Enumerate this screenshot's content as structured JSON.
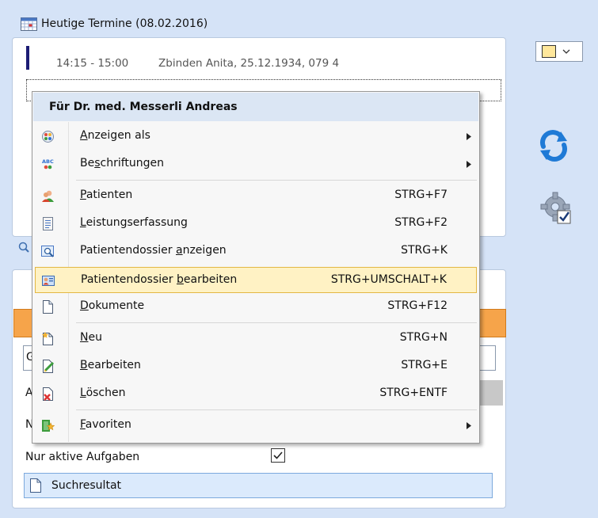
{
  "header": {
    "title": "Heutige Termine (08.02.2016)"
  },
  "appointments": [
    {
      "time": "14:15 - 15:00",
      "patient": "Zbinden Anita, 25.12.1934, 079 4"
    }
  ],
  "context_menu": {
    "title": "Für Dr. med. Messerli Andreas",
    "items": [
      {
        "pre": "",
        "acc": "A",
        "post": "nzeigen als",
        "shortcut": "",
        "icon": "display-as-icon"
      },
      {
        "pre": "Be",
        "acc": "s",
        "post": "chriftungen",
        "shortcut": "",
        "icon": "abc-labels-icon"
      },
      {
        "pre": "",
        "acc": "P",
        "post": "atienten",
        "shortcut": "STRG+F7",
        "icon": "patients-icon"
      },
      {
        "pre": "",
        "acc": "L",
        "post": "eistungserfassung",
        "shortcut": "STRG+F2",
        "icon": "service-recording-icon"
      },
      {
        "pre": "Patientendossier ",
        "acc": "a",
        "post": "nzeigen",
        "shortcut": "STRG+K",
        "icon": "view-dossier-icon"
      },
      {
        "pre": "Patientendossier ",
        "acc": "b",
        "post": "earbeiten",
        "shortcut": "STRG+UMSCHALT+K",
        "icon": "edit-dossier-icon"
      },
      {
        "pre": "",
        "acc": "D",
        "post": "okumente",
        "shortcut": "STRG+F12",
        "icon": "documents-icon"
      },
      {
        "pre": "",
        "acc": "N",
        "post": "eu",
        "shortcut": "STRG+N",
        "icon": "new-icon"
      },
      {
        "pre": "",
        "acc": "B",
        "post": "earbeiten",
        "shortcut": "STRG+E",
        "icon": "edit-icon"
      },
      {
        "pre": "",
        "acc": "L",
        "post": "öschen",
        "shortcut": "STRG+ENTF",
        "icon": "delete-icon"
      },
      {
        "pre": "",
        "acc": "F",
        "post": "avoriten",
        "shortcut": "",
        "icon": "favorites-icon"
      }
    ]
  },
  "lower_panel": {
    "stubs": [
      "G",
      "Al",
      "N"
    ],
    "active_tasks_label": "Nur aktive Aufgaben",
    "active_tasks_checked": true,
    "results_label": "Suchresultat"
  },
  "colors": {
    "highlight_fill": "#fff2c4",
    "highlight_border": "#e3b744",
    "accent_orange": "#f6a44a",
    "background": "#d5e3f7"
  }
}
